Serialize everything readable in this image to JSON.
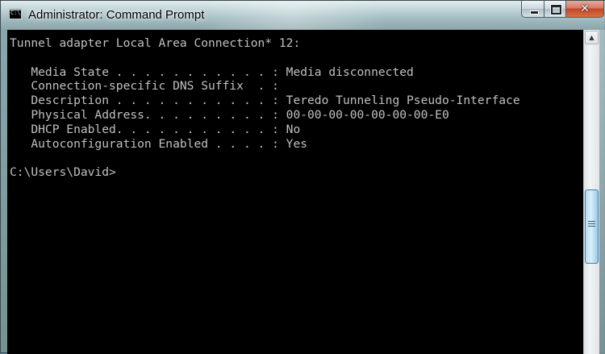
{
  "window": {
    "title": "Administrator: Command Prompt",
    "icon": "cmd-icon",
    "icon_text": "C:\\"
  },
  "controls": {
    "minimize_icon": "minimize-icon",
    "maximize_icon": "maximize-icon",
    "close_glyph": "✕"
  },
  "console": {
    "lines": [
      "Tunnel adapter Local Area Connection* 12:",
      "",
      "   Media State . . . . . . . . . . . : Media disconnected",
      "   Connection-specific DNS Suffix  . :",
      "   Description . . . . . . . . . . . : Teredo Tunneling Pseudo-Interface",
      "   Physical Address. . . . . . . . . : 00-00-00-00-00-00-00-E0",
      "   DHCP Enabled. . . . . . . . . . . : No",
      "   Autoconfiguration Enabled . . . . : Yes",
      "",
      "C:\\Users\\David>"
    ],
    "text_color": "#c0c0c0",
    "background": "#000000"
  },
  "scrollbar": {
    "up_arrow": "▲"
  }
}
